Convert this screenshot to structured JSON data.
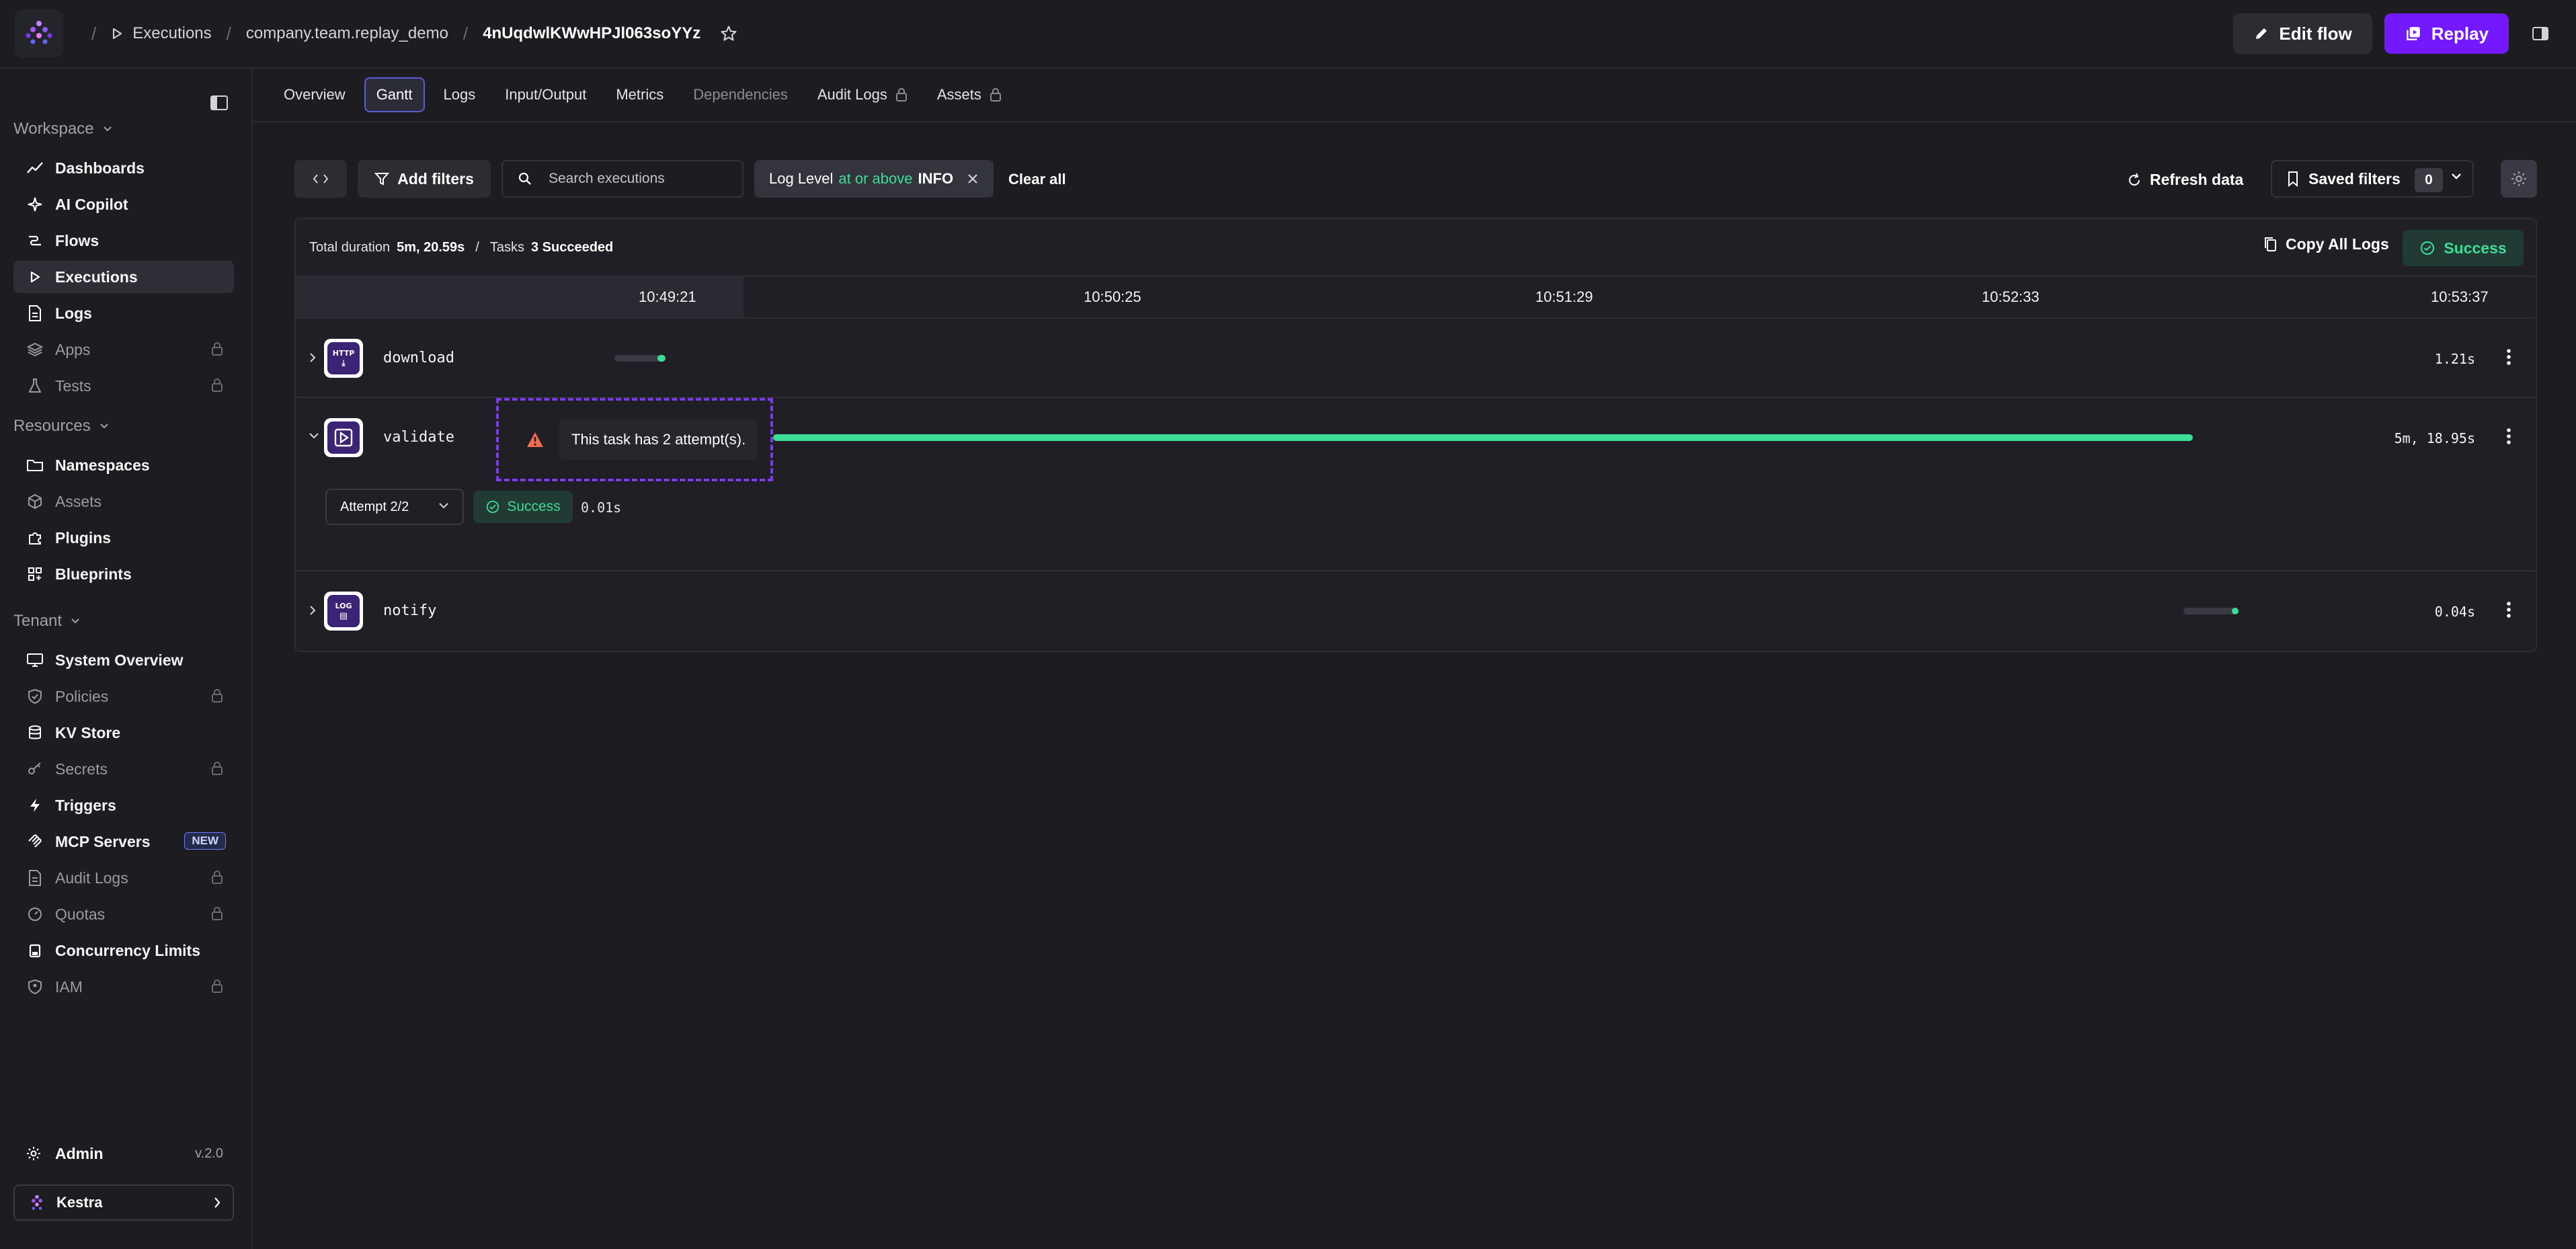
{
  "breadcrumbs": {
    "section": "Executions",
    "namespace": "company.team.replay_demo",
    "execution_id": "4nUqdwlKWwHPJl063soYYz"
  },
  "actions": {
    "edit_flow": "Edit flow",
    "replay": "Replay"
  },
  "sidebar": {
    "workspace_label": "Workspace",
    "workspace_items": [
      {
        "label": "Dashboards",
        "icon": "chart-line-icon",
        "locked": false
      },
      {
        "label": "AI Copilot",
        "icon": "sparkle-icon",
        "locked": false
      },
      {
        "label": "Flows",
        "icon": "flow-icon",
        "locked": false
      },
      {
        "label": "Executions",
        "icon": "play-icon",
        "locked": false,
        "active": true
      },
      {
        "label": "Logs",
        "icon": "file-text-icon",
        "locked": false
      },
      {
        "label": "Apps",
        "icon": "layers-icon",
        "locked": true
      },
      {
        "label": "Tests",
        "icon": "flask-icon",
        "locked": true
      }
    ],
    "resources_label": "Resources",
    "resources_items": [
      {
        "label": "Namespaces",
        "icon": "folder-icon",
        "locked": false
      },
      {
        "label": "Assets",
        "icon": "cube-icon",
        "locked": false,
        "dim": true
      },
      {
        "label": "Plugins",
        "icon": "puzzle-icon",
        "locked": false
      },
      {
        "label": "Blueprints",
        "icon": "blueprint-icon",
        "locked": false
      }
    ],
    "tenant_label": "Tenant",
    "tenant_items": [
      {
        "label": "System Overview",
        "icon": "monitor-icon",
        "locked": false
      },
      {
        "label": "Policies",
        "icon": "shield-icon",
        "locked": true
      },
      {
        "label": "KV Store",
        "icon": "database-icon",
        "locked": false
      },
      {
        "label": "Secrets",
        "icon": "key-icon",
        "locked": true
      },
      {
        "label": "Triggers",
        "icon": "lightning-icon",
        "locked": false
      },
      {
        "label": "MCP Servers",
        "icon": "mcp-icon",
        "locked": false,
        "badge": "NEW"
      },
      {
        "label": "Audit Logs",
        "icon": "file-text-icon",
        "locked": true
      },
      {
        "label": "Quotas",
        "icon": "gauge-icon",
        "locked": true
      },
      {
        "label": "Concurrency Limits",
        "icon": "lock-shape-icon",
        "locked": false
      },
      {
        "label": "IAM",
        "icon": "user-shield-icon",
        "locked": true
      }
    ],
    "admin_label": "Admin",
    "version": "v.2.0",
    "tenant_name": "Kestra"
  },
  "tabs": [
    {
      "label": "Overview"
    },
    {
      "label": "Gantt",
      "active": true
    },
    {
      "label": "Logs"
    },
    {
      "label": "Input/Output"
    },
    {
      "label": "Metrics"
    },
    {
      "label": "Dependencies",
      "dim": true
    },
    {
      "label": "Audit Logs",
      "locked": true
    },
    {
      "label": "Assets",
      "locked": true
    }
  ],
  "filters": {
    "add_filters": "Add filters",
    "search_placeholder": "Search executions",
    "chip_key": "Log Level",
    "chip_op": "at or above",
    "chip_value": "INFO",
    "clear_all": "Clear all",
    "refresh": "Refresh data",
    "saved_filters": "Saved filters",
    "saved_count": "0"
  },
  "summary": {
    "duration_label": "Total duration",
    "duration_value": "5m, 20.59s",
    "tasks_label": "Tasks",
    "tasks_value": "3 Succeeded",
    "copy_logs": "Copy All Logs",
    "status": "Success"
  },
  "timeline_ticks": [
    "10:49:21",
    "10:50:25",
    "10:51:29",
    "10:52:33",
    "10:53:37"
  ],
  "tasks": [
    {
      "name": "download",
      "duration": "1.21s",
      "icon_text": "HTTP"
    },
    {
      "name": "validate",
      "duration": "5m, 18.95s",
      "warning": "This task has 2 attempt(s)."
    },
    {
      "name": "notify",
      "duration": "0.04s",
      "icon_text": "LOG"
    }
  ],
  "attempt": {
    "label": "Attempt 2/2",
    "status": "Success",
    "duration": "0.01s"
  },
  "colors": {
    "accent": "#7418ff",
    "success": "#3ddc97",
    "warning": "#f26b4f"
  }
}
